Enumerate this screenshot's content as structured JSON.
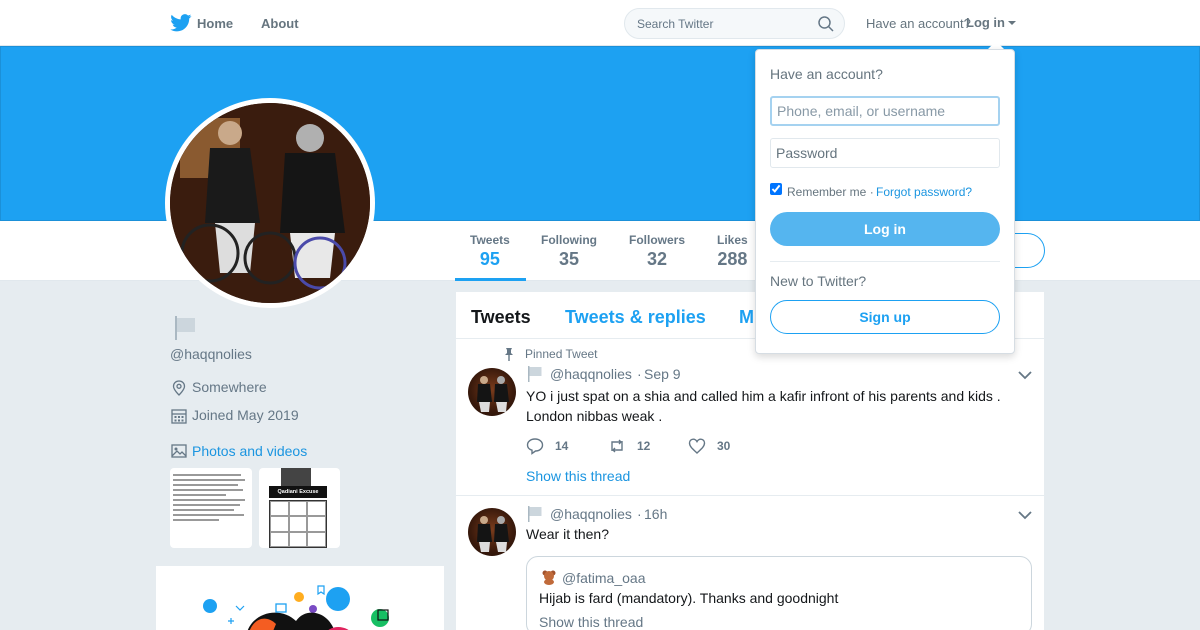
{
  "topnav": {
    "home_label": "Home",
    "about_label": "About",
    "search_placeholder": "Search Twitter",
    "have_account": "Have an account?",
    "login_label": "Log in"
  },
  "profile": {
    "handle": "@haqqnolies",
    "location": "Somewhere",
    "joined": "Joined May 2019",
    "photos_label": "Photos and videos",
    "bingo_title": "Qadiani Excuse Bingo"
  },
  "stats": [
    {
      "label": "Tweets",
      "value": "95"
    },
    {
      "label": "Following",
      "value": "35"
    },
    {
      "label": "Followers",
      "value": "32"
    },
    {
      "label": "Likes",
      "value": "288"
    }
  ],
  "timeline": {
    "tabs": [
      "Tweets",
      "Tweets & replies",
      "M"
    ],
    "tweets": [
      {
        "pinned_label": "Pinned Tweet",
        "handle": "@haqqnolies",
        "time": "Sep 9",
        "text": "YO i just spat on a shia and called  him a kafir infront of his parents and kids . London nibbas weak .",
        "replies": "14",
        "retweets": "12",
        "likes": "30",
        "show_thread": "Show this thread"
      },
      {
        "handle": "@haqqnolies",
        "time": "16h",
        "text": "Wear it then?",
        "quote": {
          "handle": "@fatima_oaa",
          "text": "Hijab is fard (mandatory). Thanks and goodnight",
          "show_thread": "Show this thread"
        }
      }
    ]
  },
  "login_dropdown": {
    "title": "Have an account?",
    "username_placeholder": "Phone, email, or username",
    "password_placeholder": "Password",
    "remember_me": "Remember me ·",
    "forgot_password": "Forgot password?",
    "login_button": "Log in",
    "new_to_twitter": "New to Twitter?",
    "signup_button": "Sign up"
  },
  "colors": {
    "accent": "#1da1f2",
    "banner": "#1da1f2",
    "background": "#e6ecf0"
  },
  "icons": [
    "twitter-bird-icon",
    "search-icon",
    "flag-icon",
    "location-icon",
    "calendar-icon",
    "photo-icon",
    "pin-icon",
    "reply-icon",
    "retweet-icon",
    "like-icon",
    "chevron-down-icon"
  ]
}
